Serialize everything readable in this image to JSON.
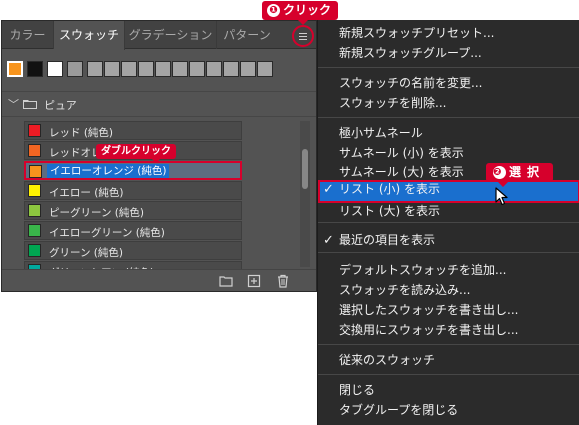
{
  "tabs": [
    {
      "label": "カラー",
      "active": false
    },
    {
      "label": "スウォッチ",
      "active": true
    },
    {
      "label": "グラデーション",
      "active": false
    },
    {
      "label": "パターン",
      "active": false
    }
  ],
  "panel": {
    "menu_icon": "hamburger-icon",
    "recent_swatches": [
      {
        "color": "#f7941d",
        "selected": true
      },
      {
        "color": "#111111",
        "selected": false
      },
      {
        "color": "#ffffff",
        "selected": false
      },
      {
        "color": "#9a9a9a",
        "selected": false
      },
      {
        "color": "#a4a4a4",
        "selected": false
      },
      {
        "color": "#a4a4a4",
        "selected": false
      },
      {
        "color": "#a4a4a4",
        "selected": false
      },
      {
        "color": "#a4a4a4",
        "selected": false
      },
      {
        "color": "#a4a4a4",
        "selected": false
      },
      {
        "color": "#a4a4a4",
        "selected": false
      },
      {
        "color": "#a4a4a4",
        "selected": false
      },
      {
        "color": "#a4a4a4",
        "selected": false
      },
      {
        "color": "#a4a4a4",
        "selected": false
      },
      {
        "color": "#a4a4a4",
        "selected": false
      },
      {
        "color": "#a4a4a4",
        "selected": false
      }
    ],
    "group_name": "ピュア",
    "swatches": [
      {
        "label": "レッド (純色)",
        "color": "#ed1c24"
      },
      {
        "label": "レッドオレンジ (純色)",
        "color": "#f26522"
      },
      {
        "label": "イエローオレンジ (純色)",
        "color": "#f7941d",
        "selected": true
      },
      {
        "label": "イエロー (純色)",
        "color": "#fff200"
      },
      {
        "label": "ピーグリーン (純色)",
        "color": "#8dc63f"
      },
      {
        "label": "イエローグリーン (純色)",
        "color": "#39b54a"
      },
      {
        "label": "グリーン (純色)",
        "color": "#00a651"
      },
      {
        "label": "グリーンシアン (純色)",
        "color": "#00a99d"
      }
    ],
    "bottom_icons": [
      "folder-icon",
      "new-swatch-icon",
      "trash-icon"
    ]
  },
  "callouts": {
    "step1_num": "❶",
    "step1_text": "クリック",
    "step2_num": "❷",
    "step2_text": "選択",
    "double_click": "ダブルクリック"
  },
  "menu": {
    "items": [
      {
        "label": "新規スウォッチプリセット..."
      },
      {
        "label": "新規スウォッチグループ..."
      },
      {
        "label": "スウォッチの名前を変更..."
      },
      {
        "label": "スウォッチを削除..."
      },
      {
        "label": "極小サムネール"
      },
      {
        "label": "サムネール (小) を表示"
      },
      {
        "label": "サムネール (大) を表示"
      },
      {
        "label": "リスト (小) を表示",
        "checked": true,
        "highlighted": true
      },
      {
        "label": "リスト (大) を表示"
      },
      {
        "label": "最近の項目を表示",
        "checked": true
      },
      {
        "label": "デフォルトスウォッチを追加..."
      },
      {
        "label": "スウォッチを読み込み..."
      },
      {
        "label": "選択したスウォッチを書き出し..."
      },
      {
        "label": "交換用にスウォッチを書き出し..."
      },
      {
        "label": "従来のスウォッチ"
      },
      {
        "label": "閉じる"
      },
      {
        "label": "タブグループを閉じる"
      }
    ],
    "check_glyph": "✓"
  },
  "colors": {
    "accent_red": "#d6002c",
    "highlight_blue": "#1a6fce",
    "panel_bg": "#535353",
    "menu_bg": "#2b2b2b"
  }
}
